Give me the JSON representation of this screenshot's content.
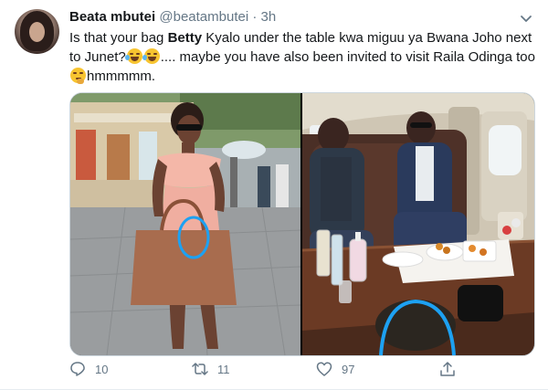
{
  "tweet": {
    "author_name": "Beata mbutei",
    "author_handle": "@beatambutei",
    "separator": "·",
    "time": "3h",
    "text_part1": "Is that your bag ",
    "text_bold": "Betty",
    "text_part2": " Kyalo under the table kwa miguu ya Bwana Joho next to Junet?",
    "text_part3": ".... maybe you have also been invited to visit Raila Odinga too",
    "text_part4": "hmmmmm.",
    "emojis": [
      "face-with-tears-of-joy-icon",
      "thinking-face-icon"
    ]
  },
  "actions": {
    "reply_count": "10",
    "retweet_count": "11",
    "like_count": "97"
  },
  "colors": {
    "text": "#14171a",
    "secondary": "#657786",
    "border": "#ccd6dd",
    "annotation_circle": "#1da1f2"
  }
}
